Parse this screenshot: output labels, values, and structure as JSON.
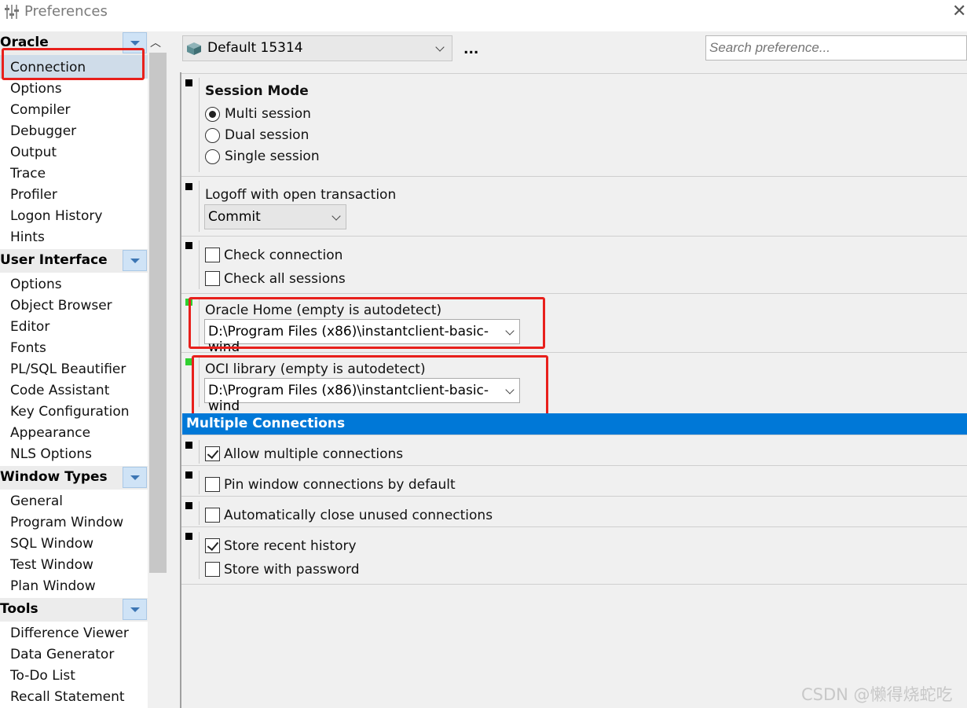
{
  "window": {
    "title": "Preferences",
    "close_icon": "close-icon"
  },
  "sidebar": {
    "categories": [
      {
        "label": "Oracle",
        "items": [
          "Connection",
          "Options",
          "Compiler",
          "Debugger",
          "Output",
          "Trace",
          "Profiler",
          "Logon History",
          "Hints"
        ]
      },
      {
        "label": "User Interface",
        "items": [
          "Options",
          "Object Browser",
          "Editor",
          "Fonts",
          "PL/SQL Beautifier",
          "Code Assistant",
          "Key Configuration",
          "Appearance",
          "NLS Options"
        ]
      },
      {
        "label": "Window Types",
        "items": [
          "General",
          "Program Window",
          "SQL Window",
          "Test Window",
          "Plan Window"
        ]
      },
      {
        "label": "Tools",
        "items": [
          "Difference Viewer",
          "Data Generator",
          "To-Do List",
          "Recall Statement"
        ]
      }
    ],
    "selected": "Connection"
  },
  "toolbar": {
    "connection_value": "Default 15314",
    "more_label": "...",
    "search_placeholder": "Search preference..."
  },
  "session_mode": {
    "title": "Session Mode",
    "options": [
      "Multi session",
      "Dual session",
      "Single session"
    ],
    "selected": "Multi session"
  },
  "logoff": {
    "label": "Logoff with open transaction",
    "value": "Commit"
  },
  "checks": {
    "check_connection": "Check connection",
    "check_all_sessions": "Check all sessions"
  },
  "oracle_home": {
    "label": "Oracle Home (empty is autodetect)",
    "value": "D:\\Program Files (x86)\\instantclient-basic-wind"
  },
  "oci_library": {
    "label": "OCI library (empty is autodetect)",
    "value": "D:\\Program Files (x86)\\instantclient-basic-wind"
  },
  "multiple_connections": {
    "title": "Multiple Connections",
    "allow_multiple": {
      "label": "Allow multiple connections",
      "checked": true
    },
    "pin_window": {
      "label": "Pin window connections by default",
      "checked": false
    },
    "auto_close": {
      "label": "Automatically close unused connections",
      "checked": false
    },
    "store_history": {
      "label": "Store recent history",
      "checked": true
    },
    "store_password": {
      "label": "Store with password",
      "checked": false
    }
  },
  "watermark": "CSDN @懒得烧蛇吃",
  "colors": {
    "accent": "#0078d7",
    "highlight_red": "#e8201c",
    "modified_marker": "#30d030"
  }
}
